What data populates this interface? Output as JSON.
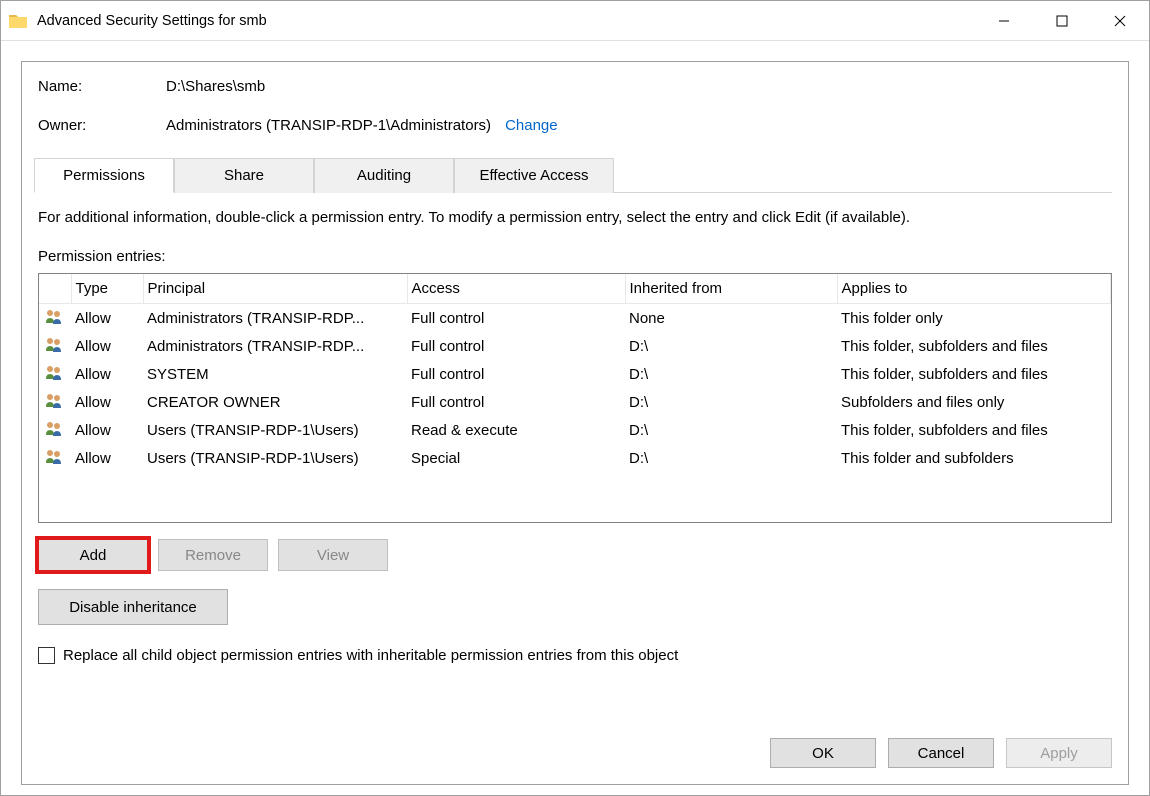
{
  "titlebar": {
    "title": "Advanced Security Settings for smb"
  },
  "info": {
    "name_label": "Name:",
    "name_value": "D:\\Shares\\smb",
    "owner_label": "Owner:",
    "owner_value": "Administrators (TRANSIP-RDP-1\\Administrators)",
    "change_link": "Change"
  },
  "tabs": {
    "permissions": "Permissions",
    "share": "Share",
    "auditing": "Auditing",
    "effective": "Effective Access"
  },
  "instruction": "For additional information, double-click a permission entry. To modify a permission entry, select the entry and click Edit (if available).",
  "entries_label": "Permission entries:",
  "columns": {
    "icon": "",
    "type": "Type",
    "principal": "Principal",
    "access": "Access",
    "inherited": "Inherited from",
    "applies": "Applies to"
  },
  "rows": [
    {
      "type": "Allow",
      "principal": "Administrators (TRANSIP-RDP...",
      "access": "Full control",
      "inherited": "None",
      "applies": "This folder only"
    },
    {
      "type": "Allow",
      "principal": "Administrators (TRANSIP-RDP...",
      "access": "Full control",
      "inherited": "D:\\",
      "applies": "This folder, subfolders and files"
    },
    {
      "type": "Allow",
      "principal": "SYSTEM",
      "access": "Full control",
      "inherited": "D:\\",
      "applies": "This folder, subfolders and files"
    },
    {
      "type": "Allow",
      "principal": "CREATOR OWNER",
      "access": "Full control",
      "inherited": "D:\\",
      "applies": "Subfolders and files only"
    },
    {
      "type": "Allow",
      "principal": "Users (TRANSIP-RDP-1\\Users)",
      "access": "Read & execute",
      "inherited": "D:\\",
      "applies": "This folder, subfolders and files"
    },
    {
      "type": "Allow",
      "principal": "Users (TRANSIP-RDP-1\\Users)",
      "access": "Special",
      "inherited": "D:\\",
      "applies": "This folder and subfolders"
    }
  ],
  "buttons": {
    "add": "Add",
    "remove": "Remove",
    "view": "View",
    "disable_inheritance": "Disable inheritance"
  },
  "checkbox_label": "Replace all child object permission entries with inheritable permission entries from this object",
  "footer": {
    "ok": "OK",
    "cancel": "Cancel",
    "apply": "Apply"
  }
}
